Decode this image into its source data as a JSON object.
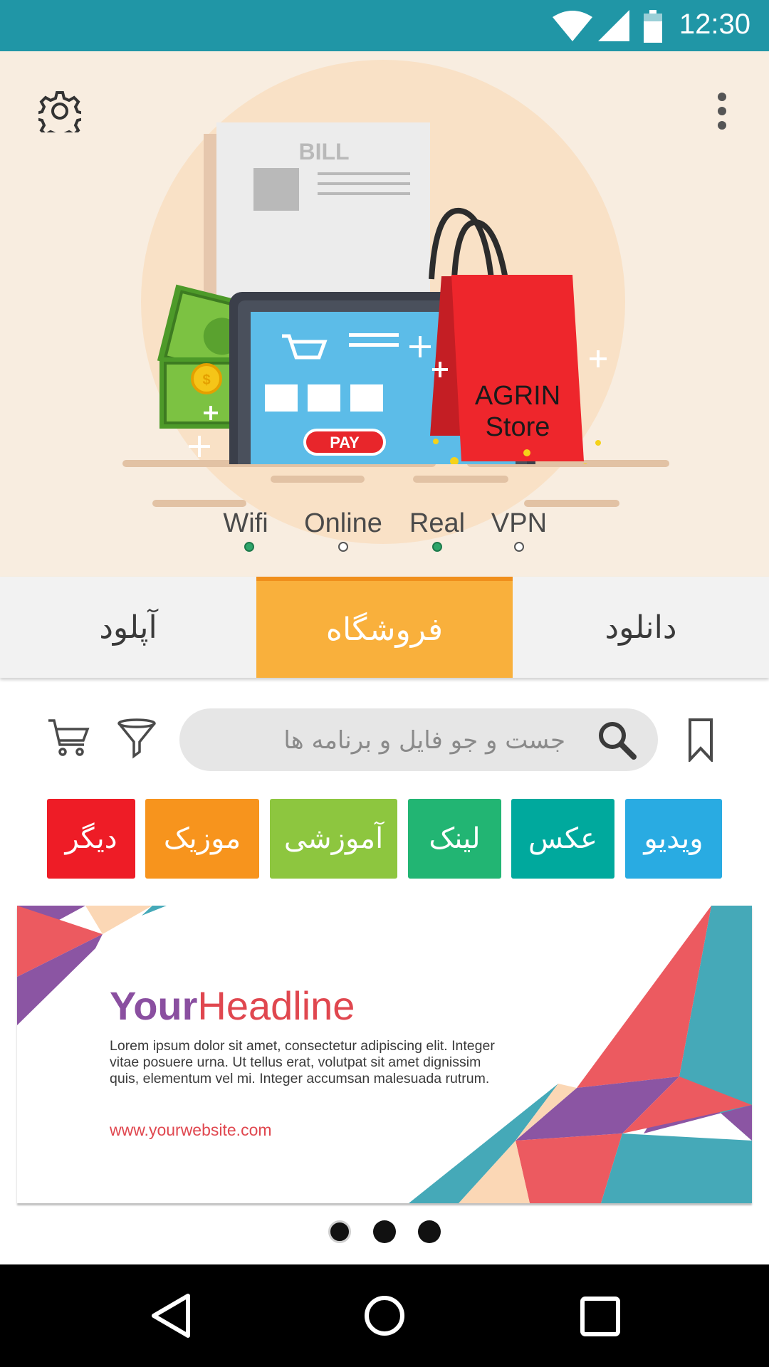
{
  "status_bar": {
    "time": "12:30",
    "icons": [
      "wifi-icon",
      "signal-icon",
      "battery-icon"
    ]
  },
  "hero": {
    "bill_label": "BILL",
    "pay_label": "PAY",
    "bag_line1": "AGRIN",
    "bag_line2": "Store",
    "status_items": [
      {
        "label": "Wifi",
        "active": true
      },
      {
        "label": "Online",
        "active": false
      },
      {
        "label": "Real",
        "active": true
      },
      {
        "label": "VPN",
        "active": false
      }
    ]
  },
  "tabs": [
    {
      "label": "آپلود",
      "selected": false
    },
    {
      "label": "فروشگاه",
      "selected": true
    },
    {
      "label": "دانلود",
      "selected": false
    }
  ],
  "search": {
    "placeholder": "جست و جو فایل و برنامه ها"
  },
  "categories": [
    {
      "label": "دیگر",
      "color": "#ee1c26"
    },
    {
      "label": "موزیک",
      "color": "#f7941d"
    },
    {
      "label": "آموزشی",
      "color": "#8dc63f"
    },
    {
      "label": "لینک",
      "color": "#22b573"
    },
    {
      "label": "عکس",
      "color": "#00a99d"
    },
    {
      "label": "ویدیو",
      "color": "#29abe2"
    }
  ],
  "banner": {
    "headline_part1": "Your",
    "headline_part2": "Headline",
    "body": "Lorem ipsum dolor sit amet, consectetur adipiscing elit. Integer vitae posuere urna. Ut tellus erat, volutpat sit amet dignissim quis, elementum vel mi. Integer accumsan malesuada rutrum.",
    "url": "www.yourwebsite.com"
  },
  "carousel": {
    "pages": 3,
    "current": 1
  },
  "colors": {
    "status_bar": "#2096a6",
    "tab_selected": "#f9b03c",
    "hero_bg": "#f8ede0",
    "headline_purple": "#8a4fa0",
    "headline_red": "#e0474f"
  }
}
